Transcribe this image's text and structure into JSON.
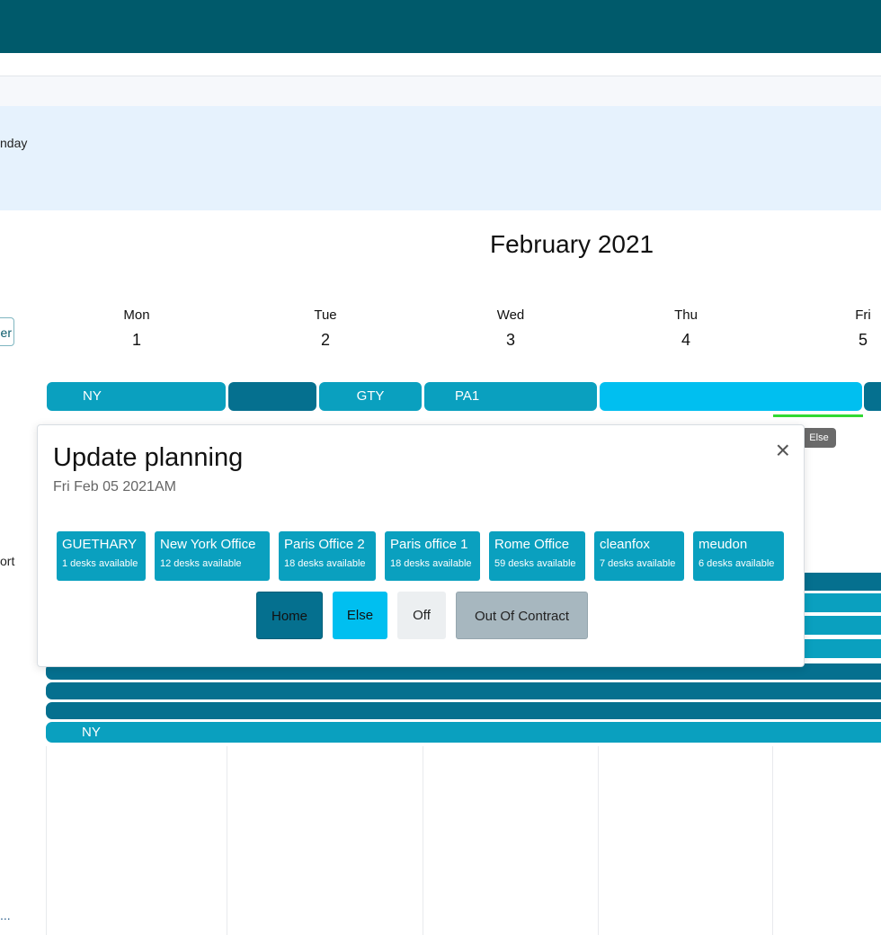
{
  "banner": {
    "text": "nday"
  },
  "calendar": {
    "month_title": "February 2021",
    "days": [
      {
        "name": "Mon",
        "num": "1"
      },
      {
        "name": "Tue",
        "num": "2"
      },
      {
        "name": "Wed",
        "num": "3"
      },
      {
        "name": "Thu",
        "num": "4"
      },
      {
        "name": "Fri",
        "num": "5"
      }
    ],
    "row1_events": [
      "NY",
      "",
      "GTY",
      "PA1",
      "",
      ""
    ],
    "bottom_bar_label": "NY"
  },
  "sidebar": {
    "button_label": "er",
    "row_label": "ort",
    "more_label": "..."
  },
  "tooltip": {
    "text": "Else"
  },
  "modal": {
    "title": "Update planning",
    "subtitle": "Fri Feb 05 2021AM",
    "close_icon": "×",
    "offices": [
      {
        "name": "GUETHARY",
        "desks": "1 desks available"
      },
      {
        "name": "New York Office",
        "desks": "12 desks available"
      },
      {
        "name": "Paris Office 2",
        "desks": "18 desks available"
      },
      {
        "name": "Paris office 1",
        "desks": "18 desks available"
      },
      {
        "name": "Rome Office",
        "desks": "59 desks available"
      },
      {
        "name": "cleanfox",
        "desks": "7 desks available"
      },
      {
        "name": "meudon",
        "desks": "6 desks available"
      }
    ],
    "statuses": {
      "home": "Home",
      "else": "Else",
      "off": "Off",
      "out_of_contract": "Out Of Contract"
    }
  },
  "colors": {
    "header": "#005a6b",
    "banner": "#e6f2fd",
    "teal": "#0aa0bf",
    "dark_teal": "#05708f",
    "bright_blue": "#00bff0",
    "off_grey": "#eceff1",
    "ooc_grey": "#a7b7bf"
  }
}
